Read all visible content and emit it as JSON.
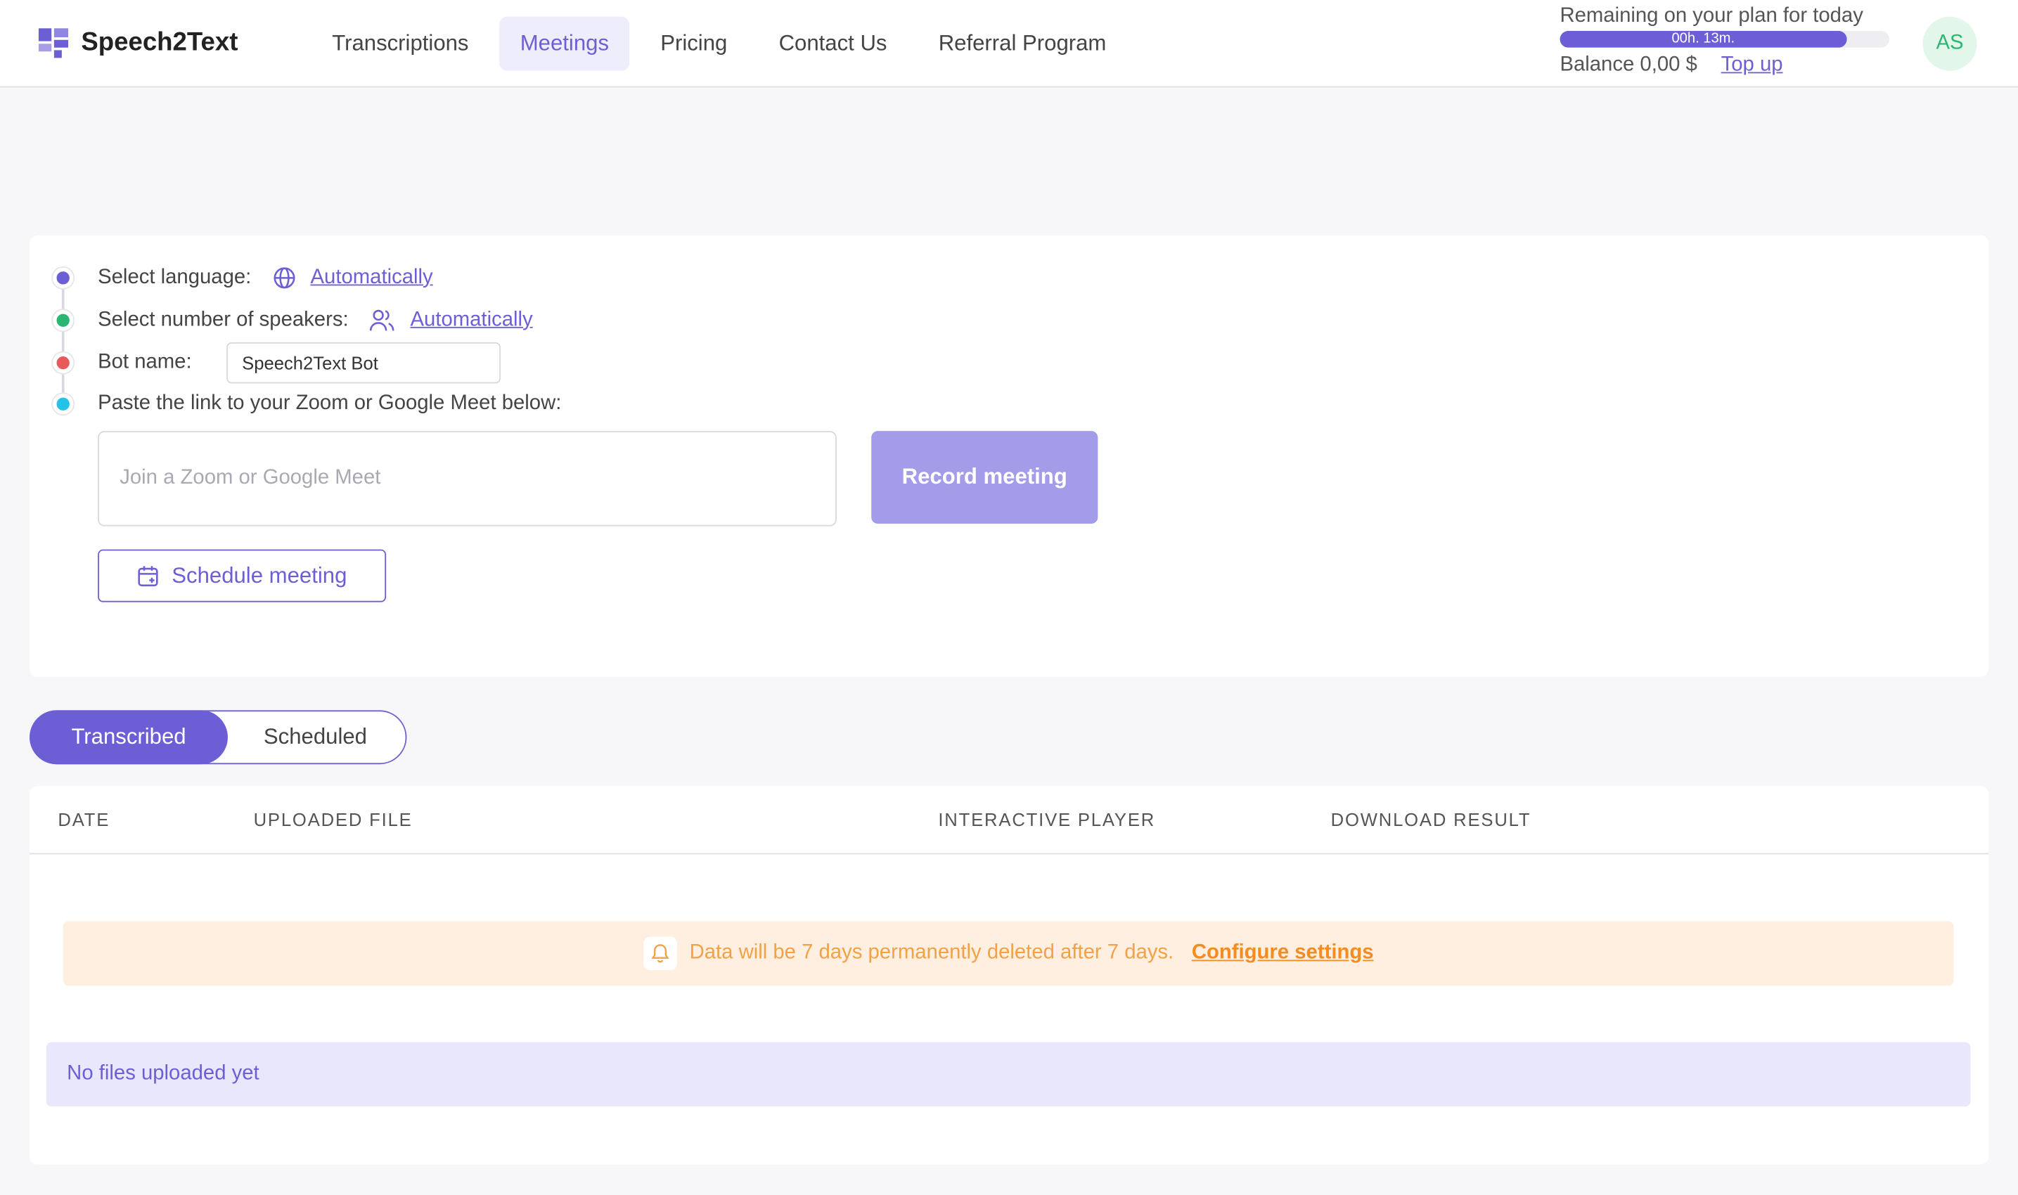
{
  "app": {
    "name": "Speech2Text"
  },
  "nav": {
    "items": [
      {
        "label": "Transcriptions",
        "active": false
      },
      {
        "label": "Meetings",
        "active": true
      },
      {
        "label": "Pricing",
        "active": false
      },
      {
        "label": "Contact Us",
        "active": false
      },
      {
        "label": "Referral Program",
        "active": false
      }
    ]
  },
  "plan": {
    "label": "Remaining on your plan for today",
    "remaining_text": "00h. 13m.",
    "progress_fraction": 0.87,
    "balance_label": "Balance 0,00 $",
    "top_up": "Top up"
  },
  "user": {
    "initials": "AS",
    "avatar_color": "#2bb673"
  },
  "settings": {
    "language_label": "Select language:",
    "language_value": "Automatically",
    "speakers_label": "Select number of speakers:",
    "speakers_value": "Automatically",
    "bot_label": "Bot name:",
    "bot_value": "Speech2Text Bot",
    "link_label": "Paste the link to your Zoom or Google Meet below:",
    "link_placeholder": "Join a Zoom or Google Meet",
    "record_button": "Record meeting",
    "schedule_button": "Schedule meeting",
    "step_colors": [
      "#6c5fd6",
      "#2bb673",
      "#e85a5a",
      "#22c3e6"
    ]
  },
  "tabs": {
    "transcribed": "Transcribed",
    "scheduled": "Scheduled"
  },
  "table": {
    "columns": [
      "DATE",
      "UPLOADED FILE",
      "INTERACTIVE PLAYER",
      "DOWNLOAD RESULT"
    ],
    "notice_text": "Data will be 7 days permanently deleted after 7 days.",
    "notice_link": "Configure settings",
    "empty_text": "No files uploaded yet"
  },
  "colors": {
    "accent": "#6c5fd6",
    "warning": "#f2a145"
  }
}
